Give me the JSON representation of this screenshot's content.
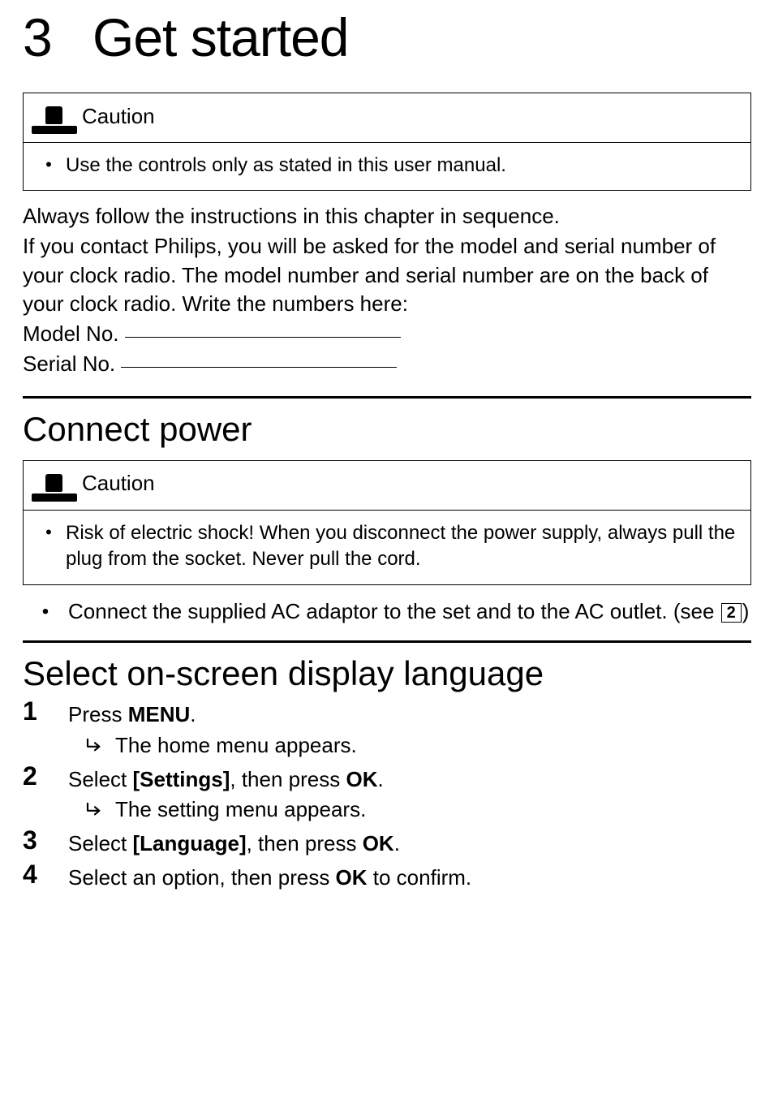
{
  "chapter": {
    "number": "3",
    "title": "Get started"
  },
  "caution1": {
    "label": "Caution",
    "item": "Use the controls only as stated in this user manual."
  },
  "intro": {
    "p1": "Always follow the instructions in this chapter in sequence.",
    "p2": "If you contact Philips, you will be asked for the model and serial number of your clock radio. The model number and serial number are on the back of your clock radio. Write the numbers here:",
    "model_label": "Model No. ",
    "serial_label": "Serial No. "
  },
  "section_power": {
    "title": "Connect power",
    "caution_label": "Caution",
    "caution_item": "Risk of electric shock! When you disconnect the power supply, always pull the plug from the socket. Never pull the cord.",
    "step_pre": "Connect the supplied AC adaptor to the set and to the AC outlet.  (see ",
    "step_ref": "2",
    "step_post": ")"
  },
  "section_lang": {
    "title": "Select on-screen display language",
    "steps": {
      "s1_pre": "Press ",
      "s1_bold": "MENU",
      "s1_post": ".",
      "s1_result": "The home menu appears.",
      "s2_pre": "Select ",
      "s2_bold1": "[Settings]",
      "s2_mid": ", then press ",
      "s2_bold2": "OK",
      "s2_post": ".",
      "s2_result": "The setting menu appears.",
      "s3_pre": "Select ",
      "s3_bold1": "[Language]",
      "s3_mid": ", then press ",
      "s3_bold2": "OK",
      "s3_post": ".",
      "s4_pre": "Select an option, then press ",
      "s4_bold": "OK",
      "s4_post": " to confirm."
    },
    "nums": {
      "n1": "1",
      "n2": "2",
      "n3": "3",
      "n4": "4"
    }
  }
}
